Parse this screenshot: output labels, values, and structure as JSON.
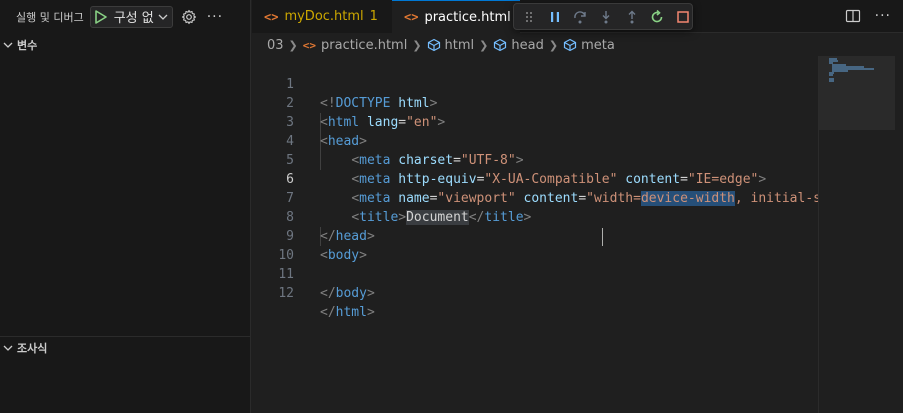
{
  "sidebar": {
    "title": "실행 및 디버그",
    "run_config_label": "구성 없",
    "more_label": "···",
    "sections": {
      "variables": "변수",
      "watch": "조사식"
    }
  },
  "tabs": [
    {
      "label": "myDoc.html",
      "count": "1"
    },
    {
      "label": "practice.html"
    }
  ],
  "debug_toolbar": {
    "drag_icon": "gripper-icon",
    "buttons": [
      "pause-icon",
      "step-over-icon",
      "step-into-icon",
      "step-out-icon",
      "restart-icon",
      "stop-icon"
    ]
  },
  "editor_actions": {
    "more_label": "···"
  },
  "breadcrumb": {
    "folder": "03",
    "file": "practice.html",
    "path": [
      "html",
      "head",
      "meta"
    ]
  },
  "code_lines": [
    {
      "n": "1",
      "text": "<!DOCTYPE html>"
    },
    {
      "n": "2",
      "text": "<html lang=\"en\">"
    },
    {
      "n": "3",
      "text": "<head>"
    },
    {
      "n": "4",
      "text": "    <meta charset=\"UTF-8\">"
    },
    {
      "n": "5",
      "text": "    <meta http-equiv=\"X-UA-Compatible\" content=\"IE=edge\">"
    },
    {
      "n": "6",
      "text": "    <meta name=\"viewport\" content=\"width=device-width, initial-sc"
    },
    {
      "n": "7",
      "text": "    <title>Document</title>"
    },
    {
      "n": "8",
      "text": "</head>"
    },
    {
      "n": "9",
      "text": "<body>"
    },
    {
      "n": "10",
      "text": ""
    },
    {
      "n": "11",
      "text": "</body>"
    },
    {
      "n": "12",
      "text": "</html>"
    }
  ],
  "tokens": {
    "doctype_open": "<!",
    "doctype_kw": "DOCTYPE",
    "html_kw": "html",
    "gt": ">",
    "lt": "<",
    "lt_slash": "</",
    "html_tag": "html",
    "head_tag": "head",
    "body_tag": "body",
    "meta_tag": "meta",
    "title_tag": "title",
    "lang_attr": "lang",
    "lang_val": "\"en\"",
    "charset_attr": "charset",
    "charset_val": "\"UTF-8\"",
    "httpequiv_attr": "http-equiv",
    "httpequiv_val": "\"X-UA-Compatible\"",
    "content_attr": "content",
    "content_val1": "\"IE=edge\"",
    "name_attr": "name",
    "name_val": "\"viewport\"",
    "content_val2_pre": "\"width=",
    "content_val2_sel": "device-width",
    "content_val2_post": ", initial-sc",
    "eq": "=",
    "title_text": "Document"
  },
  "colors": {
    "tag": "#569cd6",
    "attribute": "#9cdcfe",
    "string": "#ce9178",
    "warning_tab": "#cca700",
    "html_icon": "#e37933",
    "selection": "#264f78"
  }
}
